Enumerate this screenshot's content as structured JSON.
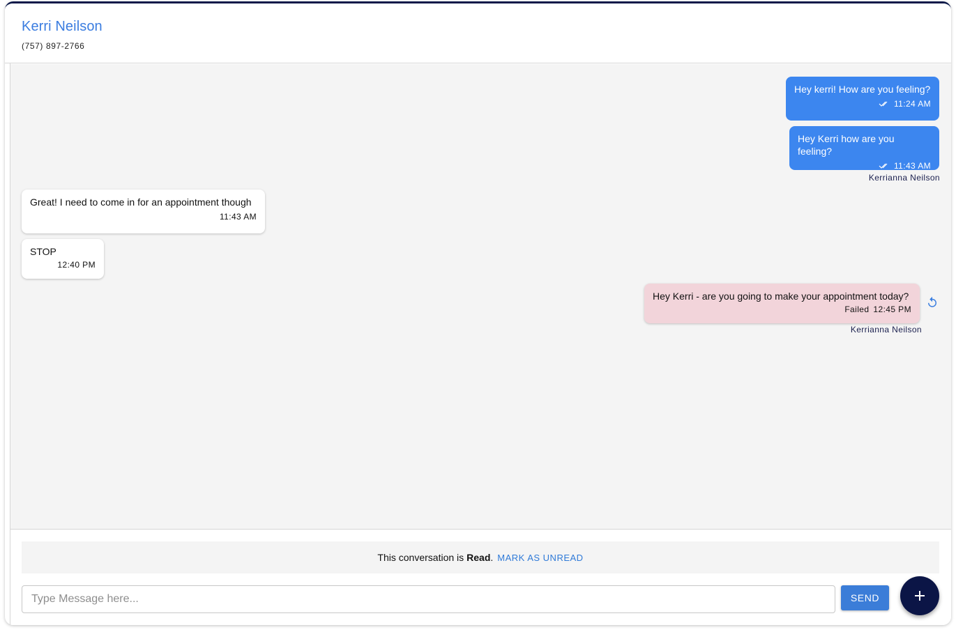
{
  "contact": {
    "name": "Kerri Neilson",
    "phone": "(757) 897-2766"
  },
  "messages": [
    {
      "direction": "outgoing",
      "text": "Hey kerri! How are you feeling?",
      "time": "11:24 AM"
    },
    {
      "direction": "outgoing",
      "text": "Hey Kerri how are you feeling?",
      "time": "11:43 AM",
      "sender": "Kerrianna Neilson"
    },
    {
      "direction": "incoming",
      "text": "Great! I need to come in for an appointment though",
      "time": "11:43 AM"
    },
    {
      "direction": "incoming",
      "text": "STOP",
      "time": "12:40 PM"
    },
    {
      "direction": "outgoing",
      "status": "Failed",
      "text": "Hey Kerri - are you going to make your appointment today?",
      "time": "12:45 PM",
      "sender": "Kerrianna Neilson"
    }
  ],
  "read_banner": {
    "prefix": "This conversation is",
    "state": "Read",
    "suffix": ".",
    "action": "MARK AS UNREAD"
  },
  "composer": {
    "placeholder": "Type Message here...",
    "send_label": "SEND",
    "fab_icon": "plus-icon",
    "fab_label": "+"
  },
  "colors": {
    "accent": "#3c86ef",
    "failed_bg": "#f2d4da",
    "fab_bg": "#0b1546",
    "thread_bg": "#f4f4f4"
  }
}
